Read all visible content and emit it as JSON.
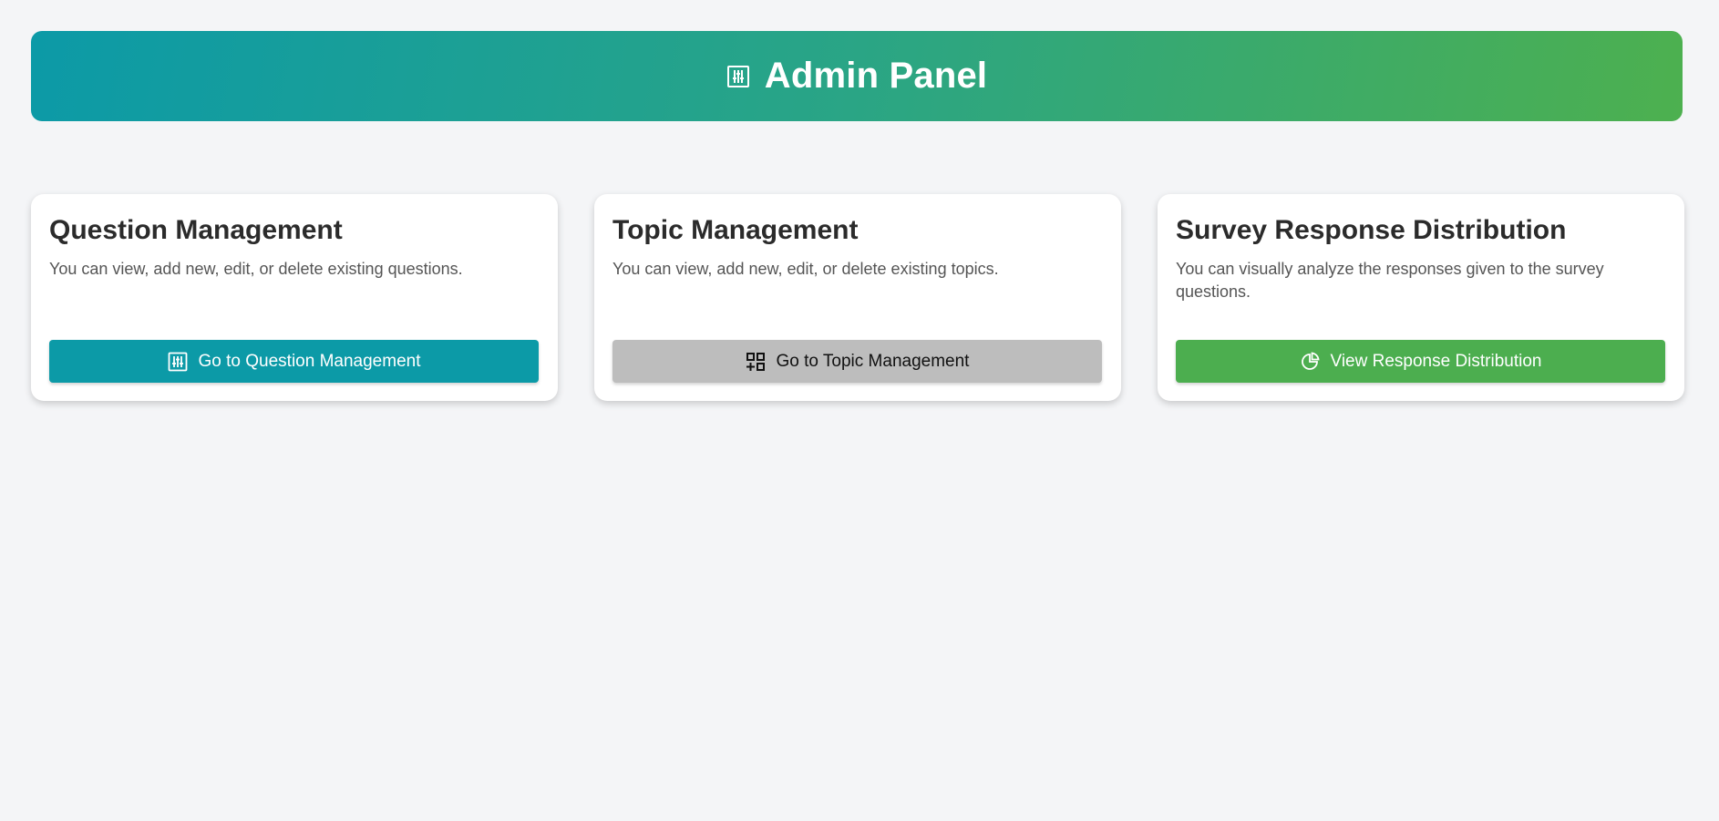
{
  "header": {
    "title": "Admin Panel",
    "icon": "sliders-icon"
  },
  "cards": [
    {
      "title": "Question Management",
      "description": "You can view, add new, edit, or delete existing questions.",
      "button_label": "Go to Question Management",
      "button_icon": "sliders-icon",
      "button_color": "#0c9aa7"
    },
    {
      "title": "Topic Management",
      "description": "You can view, add new, edit, or delete existing topics.",
      "button_label": "Go to Topic Management",
      "button_icon": "grid-icon",
      "button_color": "#bdbdbd"
    },
    {
      "title": "Survey Response Distribution",
      "description": "You can visually analyze the responses given to the survey questions.",
      "button_label": "View Response Distribution",
      "button_icon": "pie-chart-icon",
      "button_color": "#4cae4f"
    }
  ],
  "colors": {
    "background": "#f4f5f7",
    "header_gradient_start": "#0c9aa7",
    "header_gradient_end": "#4db04f"
  }
}
